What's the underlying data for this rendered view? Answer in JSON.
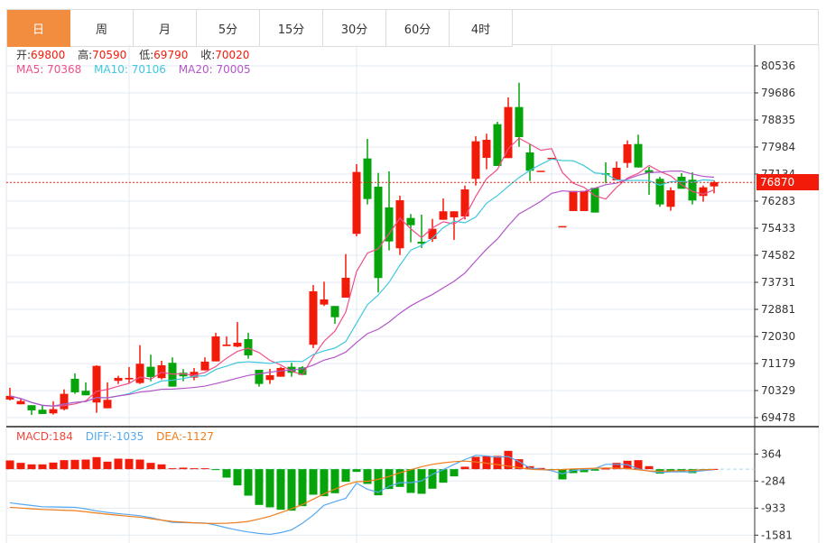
{
  "tabs": [
    "日",
    "周",
    "月",
    "5分",
    "15分",
    "30分",
    "60分",
    "4时"
  ],
  "active_tab": 0,
  "ohlc_legend": {
    "open_label": "开:",
    "open": "69800",
    "high_label": "高:",
    "high": "70590",
    "low_label": "低:",
    "low": "69790",
    "close_label": "收:",
    "close": "70020"
  },
  "ma_legend": {
    "ma5": "MA5: 70368",
    "ma10": "MA10: 70106",
    "ma20": "MA20: 70005"
  },
  "macd_legend": {
    "macd": "MACD:184",
    "diff": "DIFF:-1035",
    "dea": "DEA:-1127"
  },
  "current_price": "76870",
  "colors": {
    "up": "#f21b0a",
    "down": "#05a40b",
    "accent": "#f28c3e",
    "ma5": "#ef4f8a",
    "ma10": "#3ec8dd",
    "ma20": "#b455c9",
    "diff": "#56a8f0",
    "dea": "#f07d1c"
  },
  "chart_data": [
    {
      "type": "candlestick",
      "y_ticks": [
        80536,
        79686,
        78835,
        77984,
        77134,
        76283,
        75433,
        74582,
        73731,
        72881,
        72030,
        71179,
        70329,
        69478
      ],
      "ylim": [
        69478,
        80536
      ],
      "grid": true,
      "moving_averages": [
        5,
        10,
        20
      ],
      "current_price": 76870,
      "candles_ohlc": [
        [
          70047,
          70415,
          70019,
          70160
        ],
        [
          69897,
          70067,
          69897,
          69999
        ],
        [
          69868,
          69868,
          69565,
          69707
        ],
        [
          69727,
          69877,
          69593,
          69593
        ],
        [
          69613,
          69990,
          69574,
          69744
        ],
        [
          69744,
          70367,
          69707,
          70226
        ],
        [
          70699,
          70869,
          70226,
          70274
        ],
        [
          70322,
          70586,
          70180,
          70180
        ],
        [
          69953,
          71124,
          69630,
          71104
        ],
        [
          69772,
          70586,
          69772,
          70038
        ],
        [
          70634,
          70793,
          70537,
          70727
        ],
        [
          70679,
          71068,
          70557,
          70727
        ],
        [
          70566,
          71756,
          70537,
          71172
        ],
        [
          71076,
          71456,
          70623,
          70756
        ],
        [
          70719,
          71266,
          70679,
          71124
        ],
        [
          71201,
          71371,
          70452,
          70452
        ],
        [
          70889,
          71002,
          70623,
          70776
        ],
        [
          70736,
          71039,
          70651,
          70917
        ],
        [
          70963,
          71371,
          70963,
          71238
        ],
        [
          71246,
          72145,
          71246,
          72031
        ],
        [
          71728,
          72031,
          71728,
          71776
        ],
        [
          71711,
          72485,
          71691,
          71833
        ],
        [
          71946,
          72145,
          71331,
          71436
        ],
        [
          70982,
          70982,
          70452,
          70537
        ],
        [
          70662,
          71011,
          70537,
          70812
        ],
        [
          70764,
          71076,
          70764,
          71039
        ],
        [
          71076,
          71201,
          70764,
          70889
        ],
        [
          71059,
          71096,
          70821,
          70821
        ],
        [
          71768,
          73647,
          71663,
          73449
        ],
        [
          73032,
          73752,
          72987,
          73194
        ],
        [
          72987,
          72987,
          72428,
          72635
        ],
        [
          73250,
          74620,
          73250,
          73874
        ],
        [
          75255,
          77446,
          75178,
          77200
        ],
        [
          77625,
          78240,
          76179,
          76349
        ],
        [
          76738,
          77171,
          73412,
          73866
        ],
        [
          76085,
          77219,
          74733,
          75017
        ],
        [
          74801,
          76454,
          74591,
          76312
        ],
        [
          75754,
          75879,
          74988,
          75527
        ],
        [
          75008,
          75859,
          74810,
          74951
        ],
        [
          75093,
          75725,
          75000,
          75414
        ],
        [
          75697,
          76369,
          75697,
          75964
        ],
        [
          75774,
          75964,
          75065,
          75964
        ],
        [
          75802,
          76774,
          75708,
          76652
        ],
        [
          76984,
          78325,
          76774,
          78164
        ],
        [
          77645,
          78402,
          77285,
          78212
        ],
        [
          78702,
          78779,
          77390,
          77390
        ],
        [
          77636,
          79544,
          77636,
          79241
        ],
        [
          79241,
          80006,
          77993,
          78297
        ],
        [
          77815,
          78070,
          76916,
          77239
        ],
        [
          77239,
          77239,
          77239,
          77239
        ],
        [
          77645,
          77645,
          77645,
          77645
        ],
        [
          75499,
          75499,
          75499,
          75499
        ],
        [
          75972,
          76604,
          75972,
          76604
        ],
        [
          75972,
          76604,
          75972,
          76604
        ],
        [
          76701,
          76701,
          75924,
          75924
        ],
        [
          77163,
          77503,
          76842,
          77115
        ],
        [
          76936,
          77531,
          76936,
          77333
        ],
        [
          77483,
          78192,
          77333,
          78070
        ],
        [
          78079,
          78373,
          77341,
          77341
        ],
        [
          77256,
          77361,
          76482,
          77163
        ],
        [
          76984,
          77049,
          76105,
          76179
        ],
        [
          76105,
          76718,
          75981,
          76624
        ],
        [
          77049,
          77163,
          76672,
          76672
        ],
        [
          76956,
          77191,
          76179,
          76304
        ],
        [
          76446,
          76774,
          76264,
          76718
        ],
        [
          76746,
          76936,
          76530,
          76879
        ]
      ]
    },
    {
      "type": "bar+line",
      "y_ticks": [
        364,
        -284,
        -933,
        -1581
      ],
      "ylim": [
        -1581,
        364
      ],
      "grid": true,
      "macd_hist": [
        209,
        151,
        115,
        115,
        158,
        216,
        223,
        230,
        288,
        180,
        252,
        245,
        230,
        151,
        115,
        22,
        36,
        22,
        22,
        -14,
        -202,
        -389,
        -634,
        -857,
        -914,
        -972,
        -994,
        -886,
        -612,
        -648,
        -576,
        -302,
        -65,
        -353,
        -626,
        -475,
        -425,
        -569,
        -590,
        -468,
        -324,
        -173,
        58,
        295,
        310,
        317,
        439,
        238,
        72,
        29,
        -14,
        -245,
        -94,
        -72,
        -36,
        14,
        151,
        202,
        216,
        72,
        -108,
        -65,
        -58,
        -94,
        -14,
        5
      ],
      "diff": [
        -806,
        -840,
        -870,
        -900,
        -905,
        -910,
        -914,
        -950,
        -1000,
        -1037,
        -1065,
        -1090,
        -1116,
        -1160,
        -1220,
        -1274,
        -1280,
        -1285,
        -1289,
        -1340,
        -1404,
        -1460,
        -1505,
        -1540,
        -1562,
        -1520,
        -1454,
        -1296,
        -1100,
        -864,
        -780,
        -698,
        -338,
        -482,
        -554,
        -410,
        -324,
        -324,
        -281,
        -122,
        -14,
        115,
        230,
        331,
        317,
        288,
        302,
        180,
        29,
        0,
        -36,
        -115,
        -29,
        -14,
        14,
        115,
        115,
        108,
        7,
        -50,
        -79,
        -65,
        -65,
        -65,
        -36,
        -14
      ],
      "dea": [
        -914,
        -930,
        -950,
        -965,
        -975,
        -985,
        -994,
        -1020,
        -1050,
        -1080,
        -1105,
        -1130,
        -1152,
        -1185,
        -1220,
        -1253,
        -1270,
        -1285,
        -1296,
        -1300,
        -1296,
        -1280,
        -1253,
        -1195,
        -1130,
        -1040,
        -950,
        -850,
        -720,
        -590,
        -480,
        -374,
        -302,
        -288,
        -245,
        -173,
        -86,
        -14,
        58,
        115,
        151,
        180,
        194,
        173,
        144,
        108,
        72,
        36,
        0,
        -14,
        -14,
        -7,
        7,
        14,
        22,
        29,
        22,
        14,
        -14,
        -43,
        -50,
        -43,
        -36,
        -29,
        -14,
        -7
      ]
    }
  ]
}
